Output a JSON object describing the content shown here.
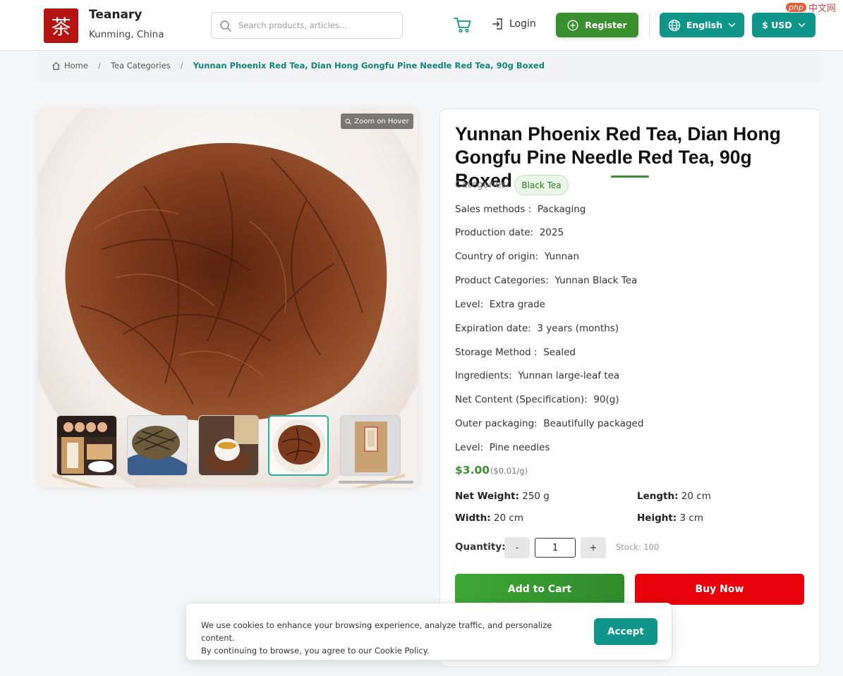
{
  "header": {
    "logo_char": "茶",
    "brand_name": "Teanary",
    "brand_location": "Kunming, China",
    "search_placeholder": "Search products, articles...",
    "login_label": "Login",
    "register_label": "Register",
    "language_label": "English",
    "currency_label": "$ USD"
  },
  "watermark": {
    "php": "php",
    "text": "中文网"
  },
  "breadcrumb": {
    "home": "Home",
    "category": "Tea Categories",
    "current": "Yunnan Phoenix Red Tea, Dian Hong Gongfu Pine Needle Red Tea, 90g Boxed"
  },
  "gallery": {
    "zoom_label": "Zoom on Hover",
    "thumbnails": [
      "boxed-tea-with-figurines",
      "dry-pine-needle-leaves-on-scoop",
      "brewed-tea-cup",
      "steeped-leaves-bowl",
      "kraft-paper-box"
    ],
    "selected_index": 3
  },
  "product": {
    "title": "Yunnan Phoenix Red Tea, Dian Hong Gongfu Pine Needle Red Tea, 90g Boxed",
    "categories_label": "Categories:",
    "category": "Black Tea",
    "attributes": [
      {
        "label": "Sales methods :",
        "value": "Packaging"
      },
      {
        "label": "Production date:",
        "value": "2025"
      },
      {
        "label": "Country of origin:",
        "value": "Yunnan"
      },
      {
        "label": "Product Categories:",
        "value": "Yunnan Black Tea"
      },
      {
        "label": "Level:",
        "value": "Extra grade"
      },
      {
        "label": "Expiration date:",
        "value": "3 years (months)"
      },
      {
        "label": "Storage Method :",
        "value": "Sealed"
      },
      {
        "label": "Ingredients:",
        "value": "Yunnan large-leaf tea"
      },
      {
        "label": "Net Content (Specification):",
        "value": "90(g)"
      },
      {
        "label": "Outer packaging:",
        "value": "Beautifully packaged"
      },
      {
        "label": "Level:",
        "value": "Pine needles"
      }
    ],
    "price": "$3.00",
    "unit_price": "($0.01/g)",
    "specs": {
      "net_weight_label": "Net Weight:",
      "net_weight": "250 g",
      "length_label": "Length:",
      "length": "20 cm",
      "width_label": "Width:",
      "width": "20 cm",
      "height_label": "Height:",
      "height": "3 cm"
    },
    "quantity_label": "Quantity:",
    "minus": "-",
    "plus": "+",
    "quantity": "1",
    "stock": "Stock: 100",
    "add_to_cart": "Add to Cart",
    "buy_now": "Buy Now"
  },
  "cookie": {
    "text_line1": "We use cookies to enhance your browsing experience, analyze traffic, and personalize content.",
    "text_line2": "By continuing to browse, you agree to our Cookie Policy.",
    "accept": "Accept"
  },
  "colors": {
    "brand_red": "#b51512",
    "green": "#3a8f2f",
    "teal": "#10958a",
    "buy_red": "#e8000b"
  }
}
